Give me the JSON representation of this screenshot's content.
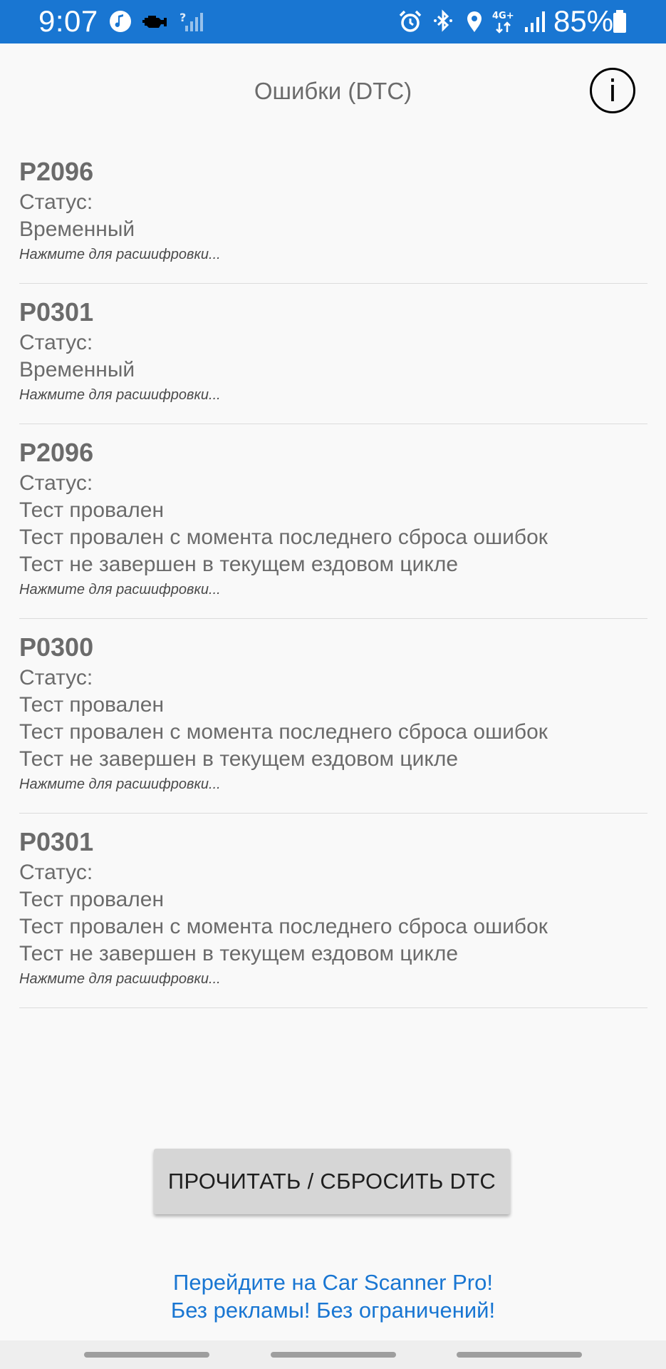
{
  "status_bar": {
    "time": "9:07",
    "battery_percent": "85%",
    "network_type": "4G+",
    "icons": [
      "music-note-icon",
      "engine-check-icon",
      "no-signal-icon",
      "alarm-icon",
      "bluetooth-icon",
      "location-icon",
      "network-4g-icon",
      "signal-icon",
      "battery-icon"
    ]
  },
  "header": {
    "title": "Ошибки (DTC)",
    "info_glyph": "i"
  },
  "dtc_list": [
    {
      "code": "P2096",
      "status_label": "Статус:",
      "statuses": [
        "Временный"
      ],
      "hint": "Нажмите для расшифровки..."
    },
    {
      "code": "P0301",
      "status_label": "Статус:",
      "statuses": [
        "Временный"
      ],
      "hint": "Нажмите для расшифровки..."
    },
    {
      "code": "P2096",
      "status_label": "Статус:",
      "statuses": [
        "Тест провален",
        "Тест провален с момента последнего сброса ошибок",
        "Тест не завершен в текущем ездовом цикле"
      ],
      "hint": "Нажмите для расшифровки..."
    },
    {
      "code": "P0300",
      "status_label": "Статус:",
      "statuses": [
        "Тест провален",
        "Тест провален с момента последнего сброса ошибок",
        "Тест не завершен в текущем ездовом цикле"
      ],
      "hint": "Нажмите для расшифровки..."
    },
    {
      "code": "P0301",
      "status_label": "Статус:",
      "statuses": [
        "Тест провален",
        "Тест провален с момента последнего сброса ошибок",
        "Тест не завершен в текущем ездовом цикле"
      ],
      "hint": "Нажмите для расшифровки..."
    }
  ],
  "action_button": {
    "label": "ПРОЧИТАТЬ / СБРОСИТЬ DTC"
  },
  "promo": {
    "line1": "Перейдите на Car Scanner Pro!",
    "line2": "Без рекламы! Без ограничений!"
  },
  "colors": {
    "status_bar": "#1976d2",
    "background": "#f9f9f9",
    "text": "#6b6b6b",
    "link": "#1976d2",
    "button": "#d6d6d6"
  }
}
